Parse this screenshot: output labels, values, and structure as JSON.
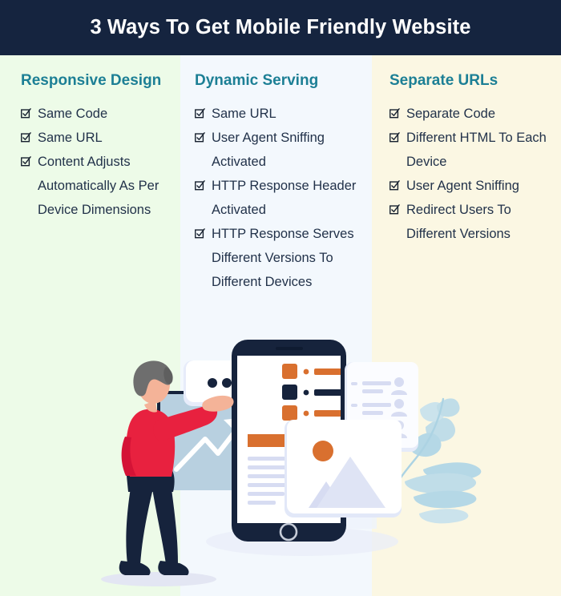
{
  "header": {
    "title": "3 Ways To Get Mobile Friendly Website",
    "background_color": "#15243f",
    "text_color": "#ffffff"
  },
  "theme": {
    "heading_color": "#1c7f95",
    "body_text_color": "#22324a",
    "column_1_bg": "#edfbe8",
    "column_2_bg": "#f3f8fd",
    "column_3_bg": "#fbf7e3",
    "accent_orange": "#d9702f",
    "accent_red": "#e8213f",
    "accent_navy": "#16233c",
    "accent_lavender": "#d7dcf2"
  },
  "columns": [
    {
      "heading": "Responsive Design",
      "items": [
        "Same Code",
        "Same URL",
        "Content Adjusts Automatically As Per Device Dimensions"
      ]
    },
    {
      "heading": "Dynamic Serving",
      "items": [
        "Same URL",
        "User Agent Sniffing Activated",
        "HTTP Response Header Activated",
        "HTTP Response Serves Different Versions To Different Devices"
      ]
    },
    {
      "heading": "Separate URLs",
      "items": [
        "Separate Code",
        "Different HTML To Each Device",
        "User Agent Sniffing",
        "Redirect Users To Different Versions"
      ]
    }
  ],
  "illustration": {
    "description": "Man in red sweater pointing at a growth chart board beside a large smartphone mockup",
    "elements": [
      "person-figure",
      "presentation-board",
      "growth-arrow",
      "speech-bubble",
      "smartphone-mockup",
      "contact-card",
      "image-placeholder-card",
      "foliage-decoration"
    ],
    "bullet_icon": "checkbox-checked-icon"
  }
}
